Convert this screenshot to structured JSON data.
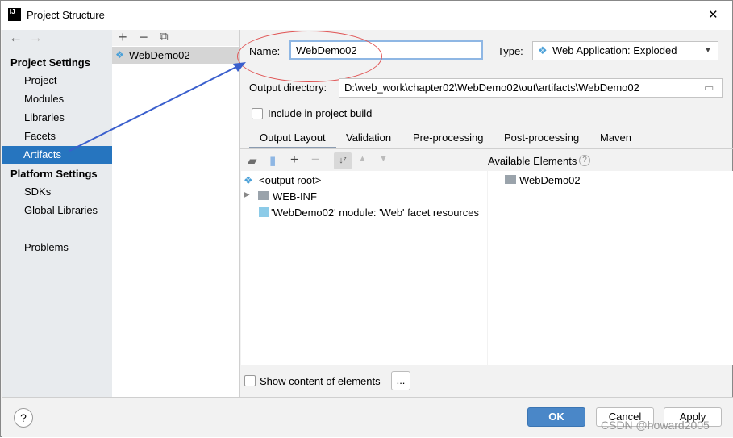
{
  "window": {
    "title": "Project Structure",
    "close": "✕",
    "logo": "IJ"
  },
  "nav": {
    "back": "←",
    "forward": "→"
  },
  "sidebar": {
    "project_settings": "Project Settings",
    "items": [
      "Project",
      "Modules",
      "Libraries",
      "Facets",
      "Artifacts"
    ],
    "selected": "Artifacts",
    "platform_settings": "Platform Settings",
    "platform_items": [
      "SDKs",
      "Global Libraries"
    ],
    "problems": "Problems"
  },
  "list": {
    "add": "+",
    "remove": "−",
    "copy": "⧉",
    "items": [
      "WebDemo02"
    ]
  },
  "form": {
    "name_label": "Name:",
    "name_value": "WebDemo02",
    "type_label": "Type:",
    "type_value": "Web Application: Exploded",
    "output_dir_label": "Output directory:",
    "output_dir_value": "D:\\web_work\\chapter02\\WebDemo02\\out\\artifacts\\WebDemo02",
    "include_label": "Include in project build",
    "include_checked": false
  },
  "tabs": [
    "Output Layout",
    "Validation",
    "Pre-processing",
    "Post-processing",
    "Maven"
  ],
  "active_tab": "Output Layout",
  "layout_tree": [
    "<output root>",
    "WEB-INF",
    "'WebDemo02' module: 'Web' facet resources"
  ],
  "available": {
    "title": "Available Elements",
    "help": "?",
    "items": [
      "WebDemo02"
    ]
  },
  "show_content": {
    "label": "Show content of elements",
    "checked": false,
    "more": "..."
  },
  "footer": {
    "help": "?",
    "ok": "OK",
    "cancel": "Cancel",
    "apply": "Apply"
  },
  "watermark": "CSDN @howard2005",
  "colors": {
    "accent": "#2675bf",
    "ok": "#4a87c8",
    "annotation": "#e05555",
    "arrow": "#3a5fcd"
  }
}
